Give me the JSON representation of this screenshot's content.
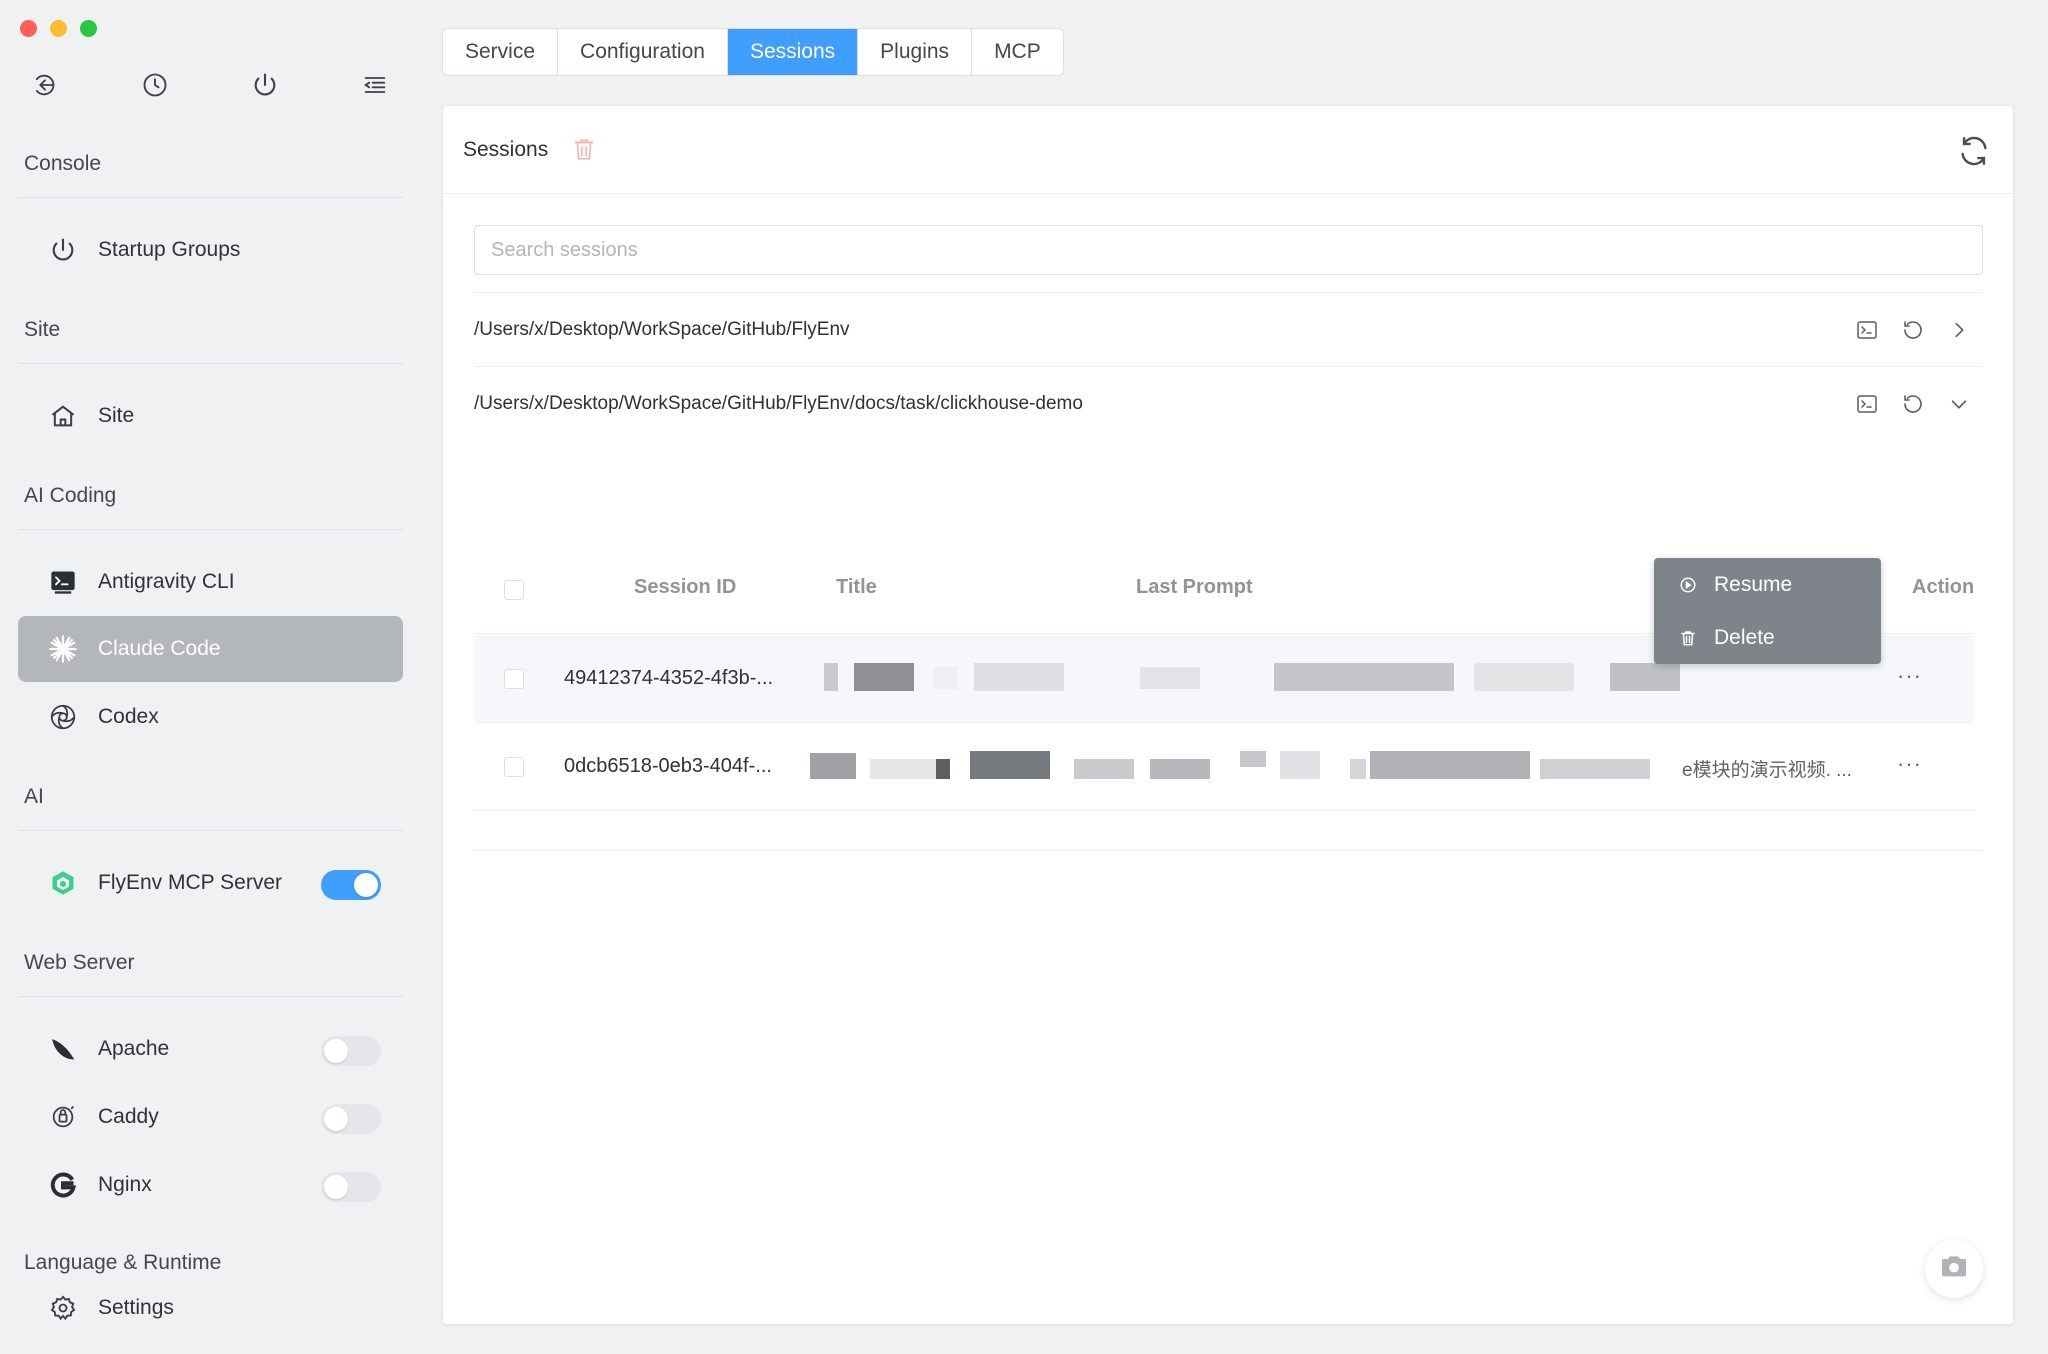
{
  "sidebar": {
    "sections": [
      {
        "title": "Console",
        "items": [
          {
            "label": "Startup Groups",
            "icon": "power-icon"
          }
        ]
      },
      {
        "title": "Site",
        "items": [
          {
            "label": "Site",
            "icon": "home-icon"
          }
        ]
      },
      {
        "title": "AI Coding",
        "items": [
          {
            "label": "Antigravity CLI",
            "icon": "terminal-icon"
          },
          {
            "label": "Claude Code",
            "icon": "claude-icon",
            "active": true
          },
          {
            "label": "Codex",
            "icon": "openai-icon"
          }
        ]
      },
      {
        "title": "AI",
        "items": [
          {
            "label": "FlyEnv MCP Server",
            "icon": "cube-icon",
            "toggle": true
          }
        ]
      },
      {
        "title": "Web Server",
        "items": [
          {
            "label": "Apache",
            "icon": "feather-icon",
            "toggle": false
          },
          {
            "label": "Caddy",
            "icon": "caddy-icon",
            "toggle": false
          },
          {
            "label": "Nginx",
            "icon": "nginx-icon",
            "toggle": false
          }
        ]
      },
      {
        "title": "Language & Runtime",
        "items": [
          {
            "label": "Settings",
            "icon": "gear-icon"
          }
        ]
      }
    ]
  },
  "tabs": [
    {
      "label": "Service"
    },
    {
      "label": "Configuration"
    },
    {
      "label": "Sessions",
      "active": true
    },
    {
      "label": "Plugins"
    },
    {
      "label": "MCP"
    }
  ],
  "panel": {
    "title": "Sessions",
    "search_placeholder": "Search sessions",
    "paths": [
      {
        "text": "/Users/x/Desktop/WorkSpace/GitHub/FlyEnv",
        "expanded": false
      },
      {
        "text": "/Users/x/Desktop/WorkSpace/GitHub/FlyEnv/docs/task/clickhouse-demo",
        "expanded": true
      }
    ],
    "columns": {
      "session_id": "Session ID",
      "title": "Title",
      "last_prompt": "Last Prompt",
      "action": "Action"
    },
    "rows": [
      {
        "session_id": "49412374-4352-4f3b-...",
        "more": "···"
      },
      {
        "session_id": "0dcb6518-0eb3-404f-...",
        "more": "···",
        "partial_text": "e模块的演示视频. ..."
      }
    ]
  },
  "popup": {
    "resume": "Resume",
    "delete": "Delete"
  },
  "colors": {
    "accent": "#409eff",
    "active_nav": "#b3b6bb",
    "popup_bg": "#7f848b",
    "danger_soft": "#f7b3b3"
  }
}
